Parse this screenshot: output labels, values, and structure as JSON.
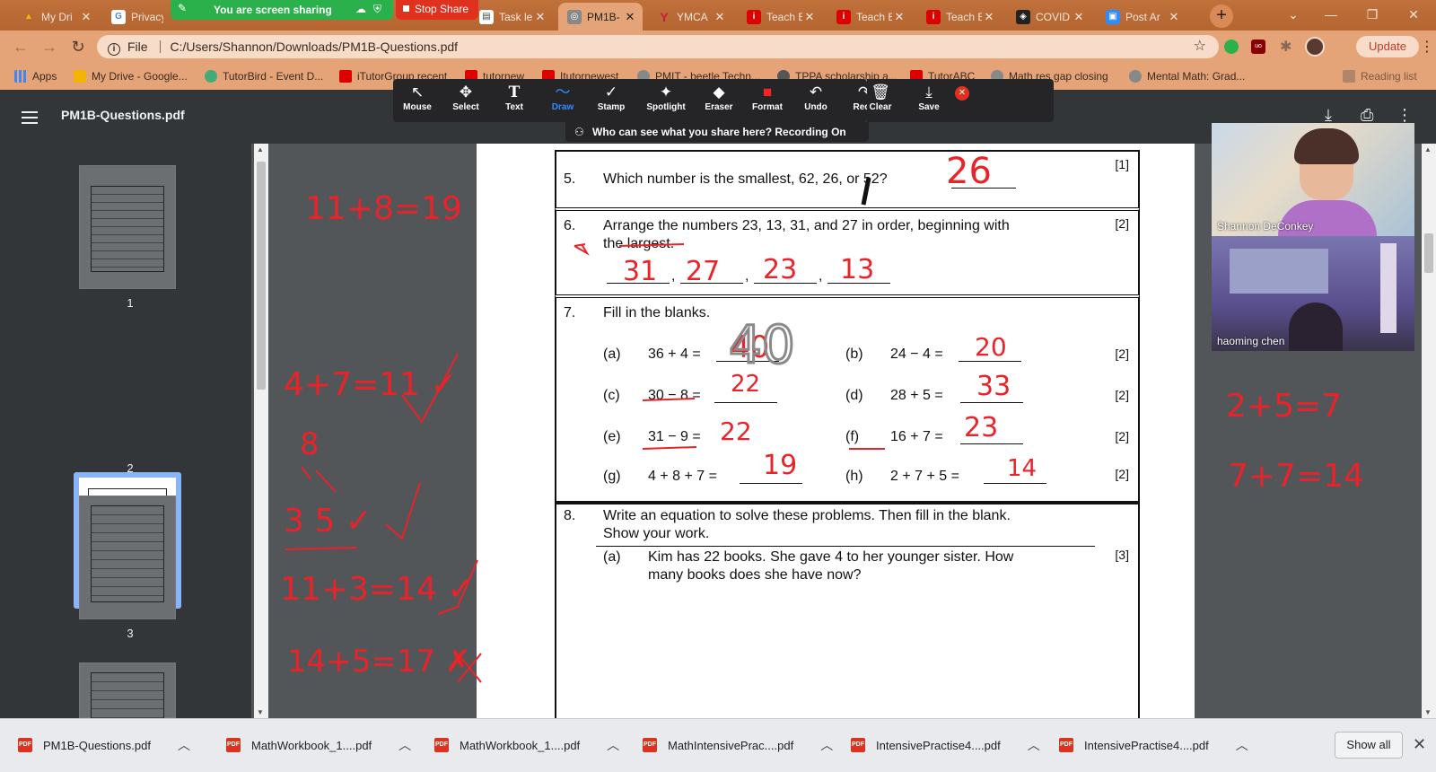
{
  "tabs": [
    {
      "title": "My Dri",
      "color": "#f4b400",
      "glyph": "▲"
    },
    {
      "title": "Privacy",
      "color": "#4285f4",
      "glyph": "G"
    },
    {
      "title": "Task le",
      "color": "#fff",
      "glyph": "▤"
    },
    {
      "title": "PM1B-",
      "color": "#888",
      "glyph": "◎"
    },
    {
      "title": "YMCA",
      "color": "#c41e3a",
      "glyph": "Y"
    },
    {
      "title": "Teach E",
      "color": "#d00",
      "glyph": "i"
    },
    {
      "title": "Teach E",
      "color": "#d00",
      "glyph": "i"
    },
    {
      "title": "Teach E",
      "color": "#d00",
      "glyph": "i"
    },
    {
      "title": "COVID",
      "color": "#222",
      "glyph": "◈"
    },
    {
      "title": "Post Ar",
      "color": "#2d8cff",
      "glyph": "▣"
    }
  ],
  "share": {
    "status": "You are screen sharing",
    "stop": "Stop Share"
  },
  "address": {
    "scheme": "File",
    "path": "C:/Users/Shannon/Downloads/PM1B-Questions.pdf",
    "update": "Update"
  },
  "bookmarks": [
    {
      "label": "Apps",
      "color": "#777"
    },
    {
      "label": "My Drive - Google...",
      "color": "#f4b400"
    },
    {
      "label": "TutorBird - Event D...",
      "color": "#4a7"
    },
    {
      "label": "iTutorGroup recent",
      "color": "#d00"
    },
    {
      "label": "tutornew",
      "color": "#d00"
    },
    {
      "label": "Itutornewest",
      "color": "#d00"
    },
    {
      "label": "PMIT - beetle Techn...",
      "color": "#888"
    },
    {
      "label": "TPPA scholarship a...",
      "color": "#555"
    },
    {
      "label": "TutorABC",
      "color": "#d00"
    },
    {
      "label": "Math res gap closing",
      "color": "#888"
    },
    {
      "label": "Mental Math: Grad...",
      "color": "#888"
    },
    {
      "label": "Reading list",
      "color": "#888"
    }
  ],
  "annotation_tools": [
    {
      "label": "Mouse",
      "glyph": "↖"
    },
    {
      "label": "Select",
      "glyph": "✥"
    },
    {
      "label": "Text",
      "glyph": "T"
    },
    {
      "label": "Draw",
      "glyph": "〜"
    },
    {
      "label": "Stamp",
      "glyph": "✓"
    },
    {
      "label": "Spotlight",
      "glyph": "✦"
    },
    {
      "label": "Eraser",
      "glyph": "◆"
    },
    {
      "label": "Format",
      "glyph": "■"
    },
    {
      "label": "Undo",
      "glyph": "↶"
    },
    {
      "label": "Redo",
      "glyph": "↷"
    },
    {
      "label": "Clear",
      "glyph": "🗑"
    },
    {
      "label": "Save",
      "glyph": "⤓"
    }
  ],
  "recording_notice": "Who can see what you share here? Recording On",
  "pdf": {
    "title": "PM1B-Questions.pdf",
    "pages": [
      "1",
      "2",
      "3"
    ]
  },
  "questions": {
    "q5": {
      "num": "5.",
      "text": "Which number is the smallest, 62, 26, or 52?",
      "mark": "[1]"
    },
    "q6": {
      "num": "6.",
      "line1": "Arrange the numbers 23, 13, 31, and 27 in order, beginning with",
      "line2": "the largest.",
      "mark": "[2]"
    },
    "q7": {
      "num": "7.",
      "text": "Fill in the blanks.",
      "items": [
        {
          "label": "(a)",
          "expr": "36 + 4 =",
          "mark": ""
        },
        {
          "label": "(b)",
          "expr": "24 − 4 =",
          "mark": "[2]"
        },
        {
          "label": "(c)",
          "expr": "30 − 8 =",
          "mark": ""
        },
        {
          "label": "(d)",
          "expr": "28 + 5 =",
          "mark": "[2]"
        },
        {
          "label": "(e)",
          "expr": "31 − 9 =",
          "mark": ""
        },
        {
          "label": "(f)",
          "expr": "16 + 7 =",
          "mark": "[2]"
        },
        {
          "label": "(g)",
          "expr": "4 + 8 + 7 =",
          "mark": ""
        },
        {
          "label": "(h)",
          "expr": "2 + 7 + 5 =",
          "mark": "[2]"
        }
      ]
    },
    "q8": {
      "num": "8.",
      "line1": "Write an equation to solve these problems. Then fill in the blank.",
      "line2": "Show your work.",
      "a_label": "(a)",
      "a_line1": "Kim has 22 books. She gave 4 to her younger sister. How",
      "a_line2": "many books does she have now?",
      "a_mark": "[3]"
    }
  },
  "handwriting": {
    "q5_answer": "26",
    "q6_answers": [
      "31",
      "27",
      "23",
      "13"
    ],
    "q7_answers": [
      "40",
      "20",
      "22",
      "33",
      "22",
      "23",
      "19",
      "14"
    ],
    "q7_extra": "40",
    "left_notes": [
      "11+8=19",
      "4+7=11 ✓",
      "8",
      "3 5 ✓",
      "11+3=14 ✓",
      "14+5=17 ✗"
    ],
    "right_notes": [
      "2+5=7",
      "7+7=14"
    ],
    "ink_color": "#e8232a",
    "grey_color": "#8a8a8a"
  },
  "participants": [
    {
      "name": "Shannon DeConkey"
    },
    {
      "name": "haoming   chen"
    }
  ],
  "downloads": [
    {
      "name": "PM1B-Questions.pdf"
    },
    {
      "name": "MathWorkbook_1....pdf"
    },
    {
      "name": "MathWorkbook_1....pdf"
    },
    {
      "name": "MathIntensivePrac....pdf"
    },
    {
      "name": "IntensivePractise4....pdf"
    },
    {
      "name": "IntensivePractise4....pdf"
    }
  ],
  "show_all": "Show all"
}
